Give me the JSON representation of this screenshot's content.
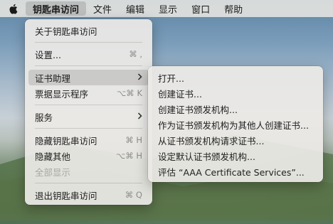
{
  "menubar": {
    "items": [
      {
        "label": "钥匙串访问"
      },
      {
        "label": "文件"
      },
      {
        "label": "编辑"
      },
      {
        "label": "显示"
      },
      {
        "label": "窗口"
      },
      {
        "label": "帮助"
      }
    ]
  },
  "app_menu": {
    "about": "关于钥匙串访问",
    "settings": "设置...",
    "settings_shortcut": "⌘ ,",
    "cert_assistant": "证书助理",
    "ticket_viewer": "票据显示程序",
    "ticket_viewer_shortcut": "⌥⌘ K",
    "services": "服务",
    "hide": "隐藏钥匙串访问",
    "hide_shortcut": "⌘ H",
    "hide_others": "隐藏其他",
    "hide_others_shortcut": "⌥⌘ H",
    "show_all": "全部显示",
    "quit": "退出钥匙串访问",
    "quit_shortcut": "⌘ Q"
  },
  "cert_submenu": {
    "items": [
      {
        "label": "打开..."
      },
      {
        "label": "创建证书..."
      },
      {
        "label": "创建证书颁发机构..."
      },
      {
        "label": "作为证书颁发机构为其他人创建证书..."
      },
      {
        "label": "从证书颁发机构请求证书..."
      },
      {
        "label": "设定默认证书颁发机构..."
      },
      {
        "label": "评估 “AAA Certificate Services”..."
      }
    ]
  }
}
